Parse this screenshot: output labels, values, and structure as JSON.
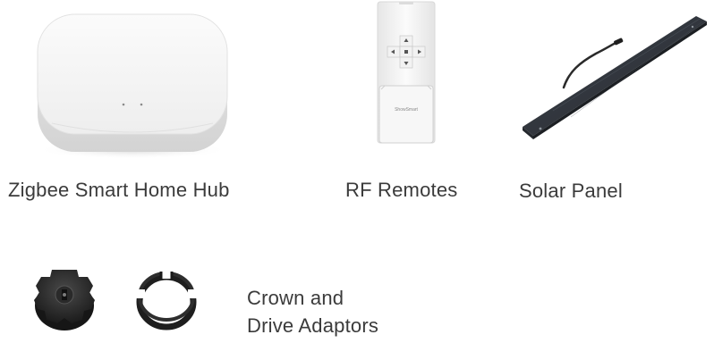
{
  "products": [
    {
      "id": "hub",
      "label": "Zigbee Smart Home Hub",
      "icon": "smart-hub-icon"
    },
    {
      "id": "remote",
      "label": "RF Remotes",
      "icon": "rf-remote-icon",
      "remote_brand": "ShowSmart"
    },
    {
      "id": "solar",
      "label": "Solar Panel",
      "icon": "solar-panel-icon"
    },
    {
      "id": "adaptors",
      "label_line1": "Crown and",
      "label_line2": "Drive Adaptors",
      "icon": "adaptor-icon"
    }
  ]
}
